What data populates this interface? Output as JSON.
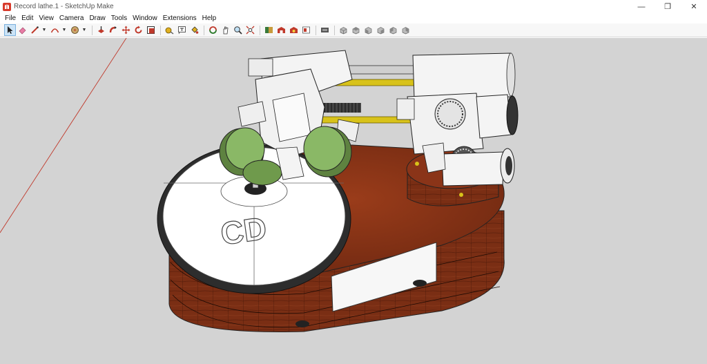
{
  "window": {
    "title": "Record lathe.1 - SketchUp Make",
    "minimize_glyph": "—",
    "restore_glyph": "❐",
    "close_glyph": "✕"
  },
  "menu": {
    "items": [
      "File",
      "Edit",
      "View",
      "Camera",
      "Draw",
      "Tools",
      "Window",
      "Extensions",
      "Help"
    ]
  },
  "toolbar": {
    "tools": [
      "select-tool-icon",
      "eraser-tool-icon",
      "line-tool-icon",
      "arc-tool-icon",
      "shape-tool-icon",
      "push-pull-tool-icon",
      "follow-me-tool-icon",
      "move-tool-icon",
      "rotate-tool-icon",
      "scale-tool-icon",
      "tape-measure-icon",
      "text-tool-icon",
      "paint-bucket-icon",
      "orbit-icon",
      "pan-icon",
      "zoom-icon",
      "zoom-extents-icon",
      "model-info-icon",
      "3d-warehouse-icon",
      "extension-warehouse-icon",
      "layout-icon",
      "send-to-layout-icon",
      "iso-view-icon",
      "top-view-icon",
      "front-view-icon",
      "right-view-icon",
      "back-view-icon"
    ]
  },
  "model": {
    "disc_label": "CD"
  },
  "colors": {
    "viewport_bg": "#d3d3d3",
    "wood": "#7a2e14",
    "wood_dark": "#5b1f0c",
    "gear_green": "#7fa55a",
    "rod_yellow": "#d8c21a",
    "part_white": "#f4f4f4",
    "axis_red": "#c0392b"
  }
}
